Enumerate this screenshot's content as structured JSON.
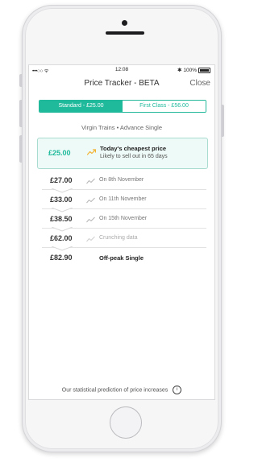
{
  "statusbar": {
    "carrier": "•••○○ ᯤ",
    "time": "12:08",
    "battery_text": "✱ 100%"
  },
  "navbar": {
    "title": "Price Tracker - BETA",
    "close_label": "Close"
  },
  "fare_class": {
    "standard_label": "Standard - £25.00",
    "first_label": "First Class - £56.00",
    "selected": "standard"
  },
  "route": "Virgin Trains • Advance Single",
  "cheapest": {
    "price": "£25.00",
    "title": "Today's cheapest price",
    "subtitle": "Likely to sell out in 65 days"
  },
  "forecast": [
    {
      "price": "£27.00",
      "label": "On 8th November",
      "state": "normal"
    },
    {
      "price": "£33.00",
      "label": "On 11th November",
      "state": "normal"
    },
    {
      "price": "£38.50",
      "label": "On 15th November",
      "state": "normal"
    },
    {
      "price": "£62.00",
      "label": "Crunching data",
      "state": "dim"
    },
    {
      "price": "£82.90",
      "label": "Off-peak Single",
      "state": "strong"
    }
  ],
  "footer": {
    "text": "Our statistical prediction of price increases",
    "info_icon": "i"
  },
  "colors": {
    "accent": "#1fba9c",
    "card_bg": "#eefaf7",
    "trend_icon_active": "#f2b233",
    "trend_icon_muted": "#b5b5b5"
  }
}
